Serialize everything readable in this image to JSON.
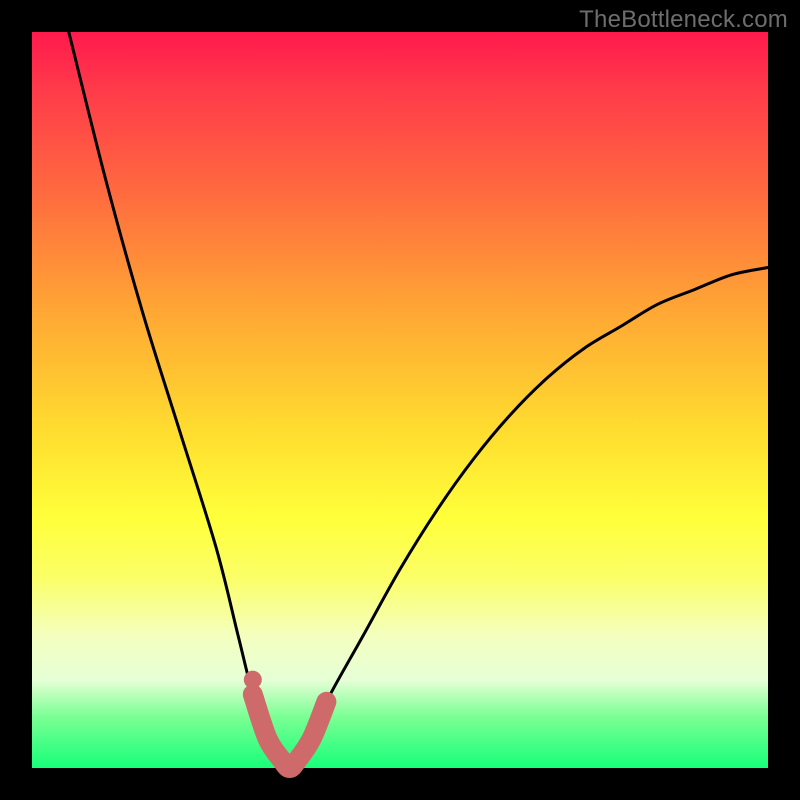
{
  "watermark": "TheBottleneck.com",
  "chart_data": {
    "type": "line",
    "title": "",
    "xlabel": "",
    "ylabel": "",
    "xlim": [
      0,
      100
    ],
    "ylim": [
      0,
      100
    ],
    "series": [
      {
        "name": "bottleneck-curve",
        "x": [
          5,
          10,
          15,
          20,
          25,
          28,
          30,
          32,
          34,
          35,
          36,
          38,
          40,
          45,
          50,
          55,
          60,
          65,
          70,
          75,
          80,
          85,
          90,
          95,
          100
        ],
        "values": [
          100,
          80,
          62,
          46,
          30,
          18,
          10,
          4,
          1,
          0,
          1,
          4,
          9,
          18,
          27,
          35,
          42,
          48,
          53,
          57,
          60,
          63,
          65,
          67,
          68
        ]
      },
      {
        "name": "highlight-segment",
        "x": [
          30,
          32,
          34,
          35,
          36,
          38,
          40
        ],
        "values": [
          10,
          4,
          1,
          0,
          1,
          4,
          9
        ]
      }
    ],
    "annotations": []
  },
  "colors": {
    "curve": "#000000",
    "highlight": "#cf6a6a",
    "highlight_dot": "#cf6a6a"
  }
}
